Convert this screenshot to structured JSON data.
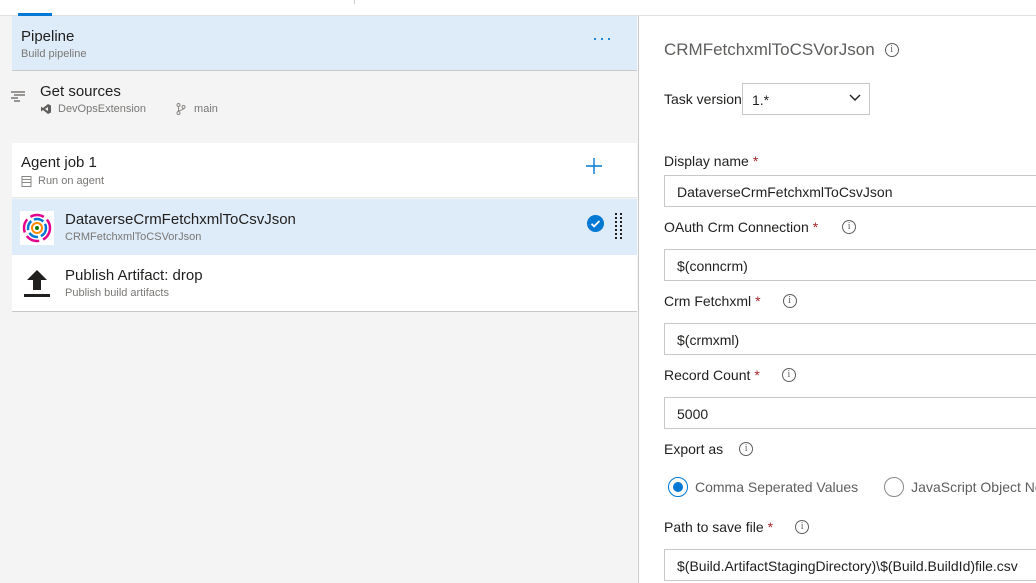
{
  "pipeline": {
    "title": "Pipeline",
    "subtitle": "Build pipeline",
    "more_label": "···"
  },
  "get_sources": {
    "title": "Get sources",
    "repo": "DevOpsExtension",
    "branch": "main"
  },
  "agent_job": {
    "title": "Agent job 1",
    "subtitle": "Run on agent"
  },
  "tasks": [
    {
      "title": "DataverseCrmFetchxmlToCsvJson",
      "subtitle": "CRMFetchxmlToCSVorJson",
      "selected": true
    },
    {
      "title": "Publish Artifact: drop",
      "subtitle": "Publish build artifacts",
      "selected": false
    }
  ],
  "details": {
    "title": "CRMFetchxmlToCSVorJson",
    "task_version_label": "Task version",
    "task_version_value": "1.*",
    "display_name_label": "Display name",
    "display_name_value": "DataverseCrmFetchxmlToCsvJson",
    "oauth_label": "OAuth Crm Connection",
    "oauth_value": "$(conncrm)",
    "fetchxml_label": "Crm Fetchxml",
    "fetchxml_value": "$(crmxml)",
    "record_count_label": "Record Count",
    "record_count_value": "5000",
    "export_as_label": "Export as",
    "export_options": [
      "Comma Seperated Values",
      "JavaScript Object Notation"
    ],
    "export_selected": "Comma Seperated Values",
    "path_label": "Path to save file",
    "path_value": "$(Build.ArtifactStagingDirectory)\\$(Build.BuildId)file.csv",
    "required_mark": "*",
    "info_glyph": "i"
  },
  "colors": {
    "accent": "#0078d4",
    "selected_bg": "#deecf9",
    "required": "#a4262c"
  }
}
